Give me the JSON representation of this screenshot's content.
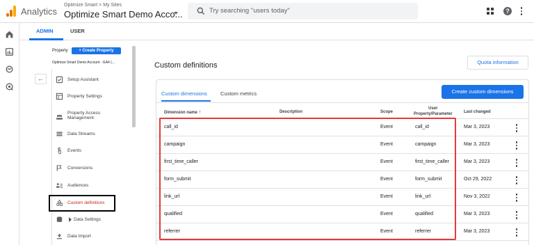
{
  "topbar": {
    "app_name": "Analytics",
    "breadcrumb": "Optimize Smart > My Sites",
    "account_name": "Optimize Smart Demo Acco...",
    "search_placeholder": "Try searching \"users today\"",
    "logo_colors": [
      "#f9ab00",
      "#e37400",
      "#e37400"
    ]
  },
  "admin_tabs": {
    "admin": "ADMIN",
    "user": "USER"
  },
  "leftnav": {
    "property_label": "Property",
    "create_property": "+ Create Property",
    "property_name": "Optimize Smart Demo Account - GA4 (...",
    "items": [
      {
        "label": "Setup Assistant",
        "icon": "checkbox-icon"
      },
      {
        "label": "Property Settings",
        "icon": "settings-page-icon"
      },
      {
        "label": "Property Access\nManagement",
        "icon": "people-icon"
      },
      {
        "label": "Data Streams",
        "icon": "streams-icon"
      },
      {
        "label": "Events",
        "icon": "touch-icon"
      },
      {
        "label": "Conversions",
        "icon": "flag-icon"
      },
      {
        "label": "Audiences",
        "icon": "audiences-icon"
      },
      {
        "label": "Custom definitions",
        "icon": "shapes-icon"
      },
      {
        "label": "Data Settings",
        "icon": "database-icon"
      },
      {
        "label": "Data Import",
        "icon": "upload-icon"
      }
    ]
  },
  "main": {
    "title": "Custom definitions",
    "quota_button": "Quota information",
    "tabs": [
      "Custom dimensions",
      "Custom metrics"
    ],
    "create_button": "Create custom dimensions",
    "columns": {
      "name": "Dimension name",
      "description": "Description",
      "scope": "Scope",
      "user_param": "User\nProperty/Parameter",
      "last_changed": "Last changed"
    },
    "rows": [
      {
        "name": "call_id",
        "description": "",
        "scope": "Event",
        "param": "call_id",
        "date": "Mar 3, 2023"
      },
      {
        "name": "campaign",
        "description": "",
        "scope": "Event",
        "param": "campaign",
        "date": "Mar 3, 2023"
      },
      {
        "name": "first_time_caller",
        "description": "",
        "scope": "Event",
        "param": "first_time_caller",
        "date": "Mar 3, 2023"
      },
      {
        "name": "form_submit",
        "description": "",
        "scope": "Event",
        "param": "form_submit",
        "date": "Oct 29, 2022"
      },
      {
        "name": "link_url",
        "description": "",
        "scope": "Event",
        "param": "link_url",
        "date": "Nov 3, 2022"
      },
      {
        "name": "qualified",
        "description": "",
        "scope": "Event",
        "param": "qualified",
        "date": "Mar 3, 2023"
      },
      {
        "name": "referrer",
        "description": "",
        "scope": "Event",
        "param": "referrer",
        "date": "Mar 3, 2023"
      }
    ]
  },
  "colors": {
    "accent": "#1a73e8",
    "highlight": "#e53935",
    "active_nav": "#c5221f"
  }
}
